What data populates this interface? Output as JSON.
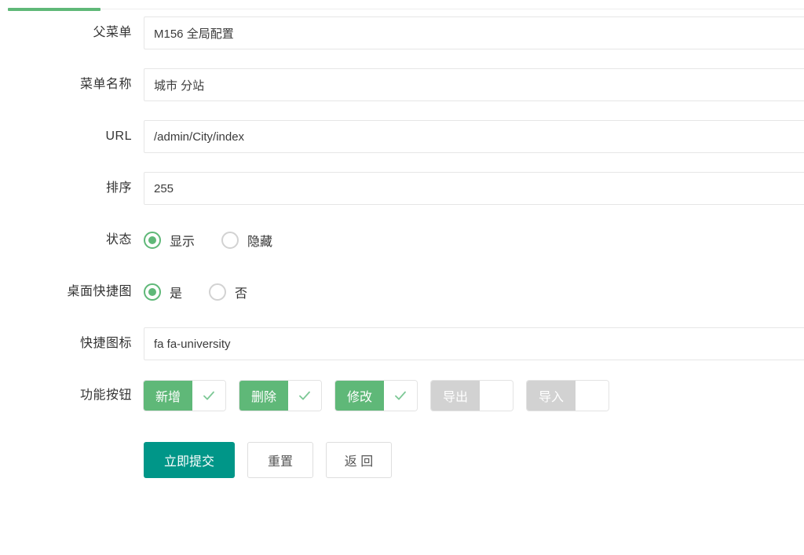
{
  "tabstrip": {
    "active_tab_present": true,
    "accent_color": "#5FB878"
  },
  "form": {
    "rows": [
      {
        "label": "父菜单",
        "value": "M156 全局配置",
        "placeholder": ""
      },
      {
        "label": "菜单名称",
        "value": "城市 分站",
        "placeholder": ""
      },
      {
        "label": "URL",
        "value": "/admin/City/index",
        "placeholder": ""
      },
      {
        "label": "排序",
        "value": "255",
        "placeholder": ""
      }
    ],
    "status": {
      "label": "状态",
      "options": [
        {
          "label": "显示",
          "checked": true
        },
        {
          "label": "隐藏",
          "checked": false
        }
      ]
    },
    "shortcut": {
      "label": "桌面快捷图",
      "options": [
        {
          "label": "是",
          "checked": true
        },
        {
          "label": "否",
          "checked": false
        }
      ]
    },
    "icon_field": {
      "label": "快捷图标",
      "value": "fa fa-university",
      "placeholder": ""
    },
    "function_buttons": {
      "label": "功能按钮",
      "items": [
        {
          "name": "新增",
          "checked": true
        },
        {
          "name": "删除",
          "checked": true
        },
        {
          "name": "修改",
          "checked": true
        },
        {
          "name": "导出",
          "checked": false
        },
        {
          "name": "导入",
          "checked": false
        }
      ]
    }
  },
  "actions": {
    "submit_label": "立即提交",
    "reset_label": "重置",
    "back_label": "返 回"
  },
  "colors": {
    "green": "#5FB878",
    "teal": "#009688",
    "disabled_gray": "#d2d2d2"
  }
}
